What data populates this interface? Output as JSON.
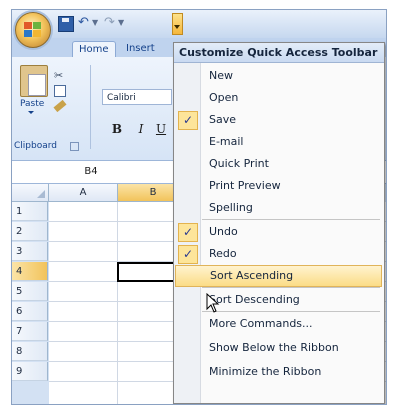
{
  "quick_access": {
    "undo_glyph": "↶",
    "redo_glyph": "↷",
    "dropdown_glyph": "▾"
  },
  "tabs": [
    "Home",
    "Insert"
  ],
  "ribbon": {
    "paste_label": "Paste",
    "cut_glyph": "✂",
    "clipboard_label": "Clipboard",
    "font_name": "Calibri",
    "bold_label": "B",
    "italic_label": "I",
    "underline_label": "U"
  },
  "name_box": "B4",
  "columns": [
    "A",
    "B"
  ],
  "rows": [
    "1",
    "2",
    "3",
    "4",
    "5",
    "6",
    "7",
    "8",
    "9"
  ],
  "menu": {
    "title": "Customize Quick Access Toolbar",
    "check_glyph": "✓",
    "items": [
      {
        "label": "New",
        "checked": false
      },
      {
        "label": "Open",
        "checked": false
      },
      {
        "label": "Save",
        "checked": true
      },
      {
        "label": "E-mail",
        "checked": false
      },
      {
        "label": "Quick Print",
        "checked": false
      },
      {
        "label": "Print Preview",
        "checked": false
      },
      {
        "label": "Spelling",
        "checked": false
      },
      {
        "label": "Undo",
        "checked": true
      },
      {
        "label": "Redo",
        "checked": true
      },
      {
        "label": "Sort Ascending",
        "checked": false,
        "hover": true
      },
      {
        "label": "Sort Descending",
        "checked": false
      },
      {
        "label": "More Commands...",
        "checked": false
      },
      {
        "label": "Show Below the Ribbon",
        "checked": false
      },
      {
        "label": "Minimize the Ribbon",
        "checked": false
      }
    ]
  },
  "colors": {
    "ribbon_blue": "#d3e1f3",
    "highlight": "#fbdc86",
    "check_bg": "#fde59a",
    "text": "#15253d"
  }
}
